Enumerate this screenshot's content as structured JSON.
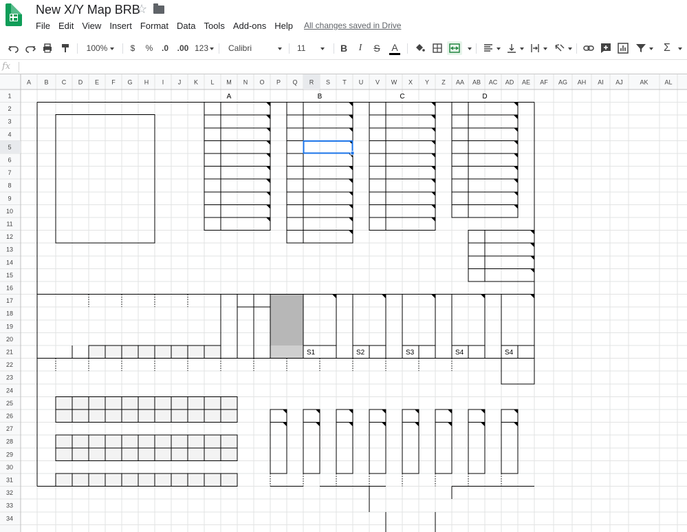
{
  "app": {
    "title": "New X/Y Map BRB",
    "save_status": "All changes saved in Drive"
  },
  "menu": [
    "File",
    "Edit",
    "View",
    "Insert",
    "Format",
    "Data",
    "Tools",
    "Add-ons",
    "Help"
  ],
  "toolbar": {
    "zoom": "100%",
    "currency": "$",
    "percent": "%",
    "decrease_decimal": ".0",
    "increase_decimal": ".00",
    "number_format": "123",
    "font": "Calibri",
    "font_size": "11",
    "bold": "B",
    "italic": "I",
    "strikethrough": "S",
    "text_color": "A",
    "icons": [
      "undo-icon",
      "redo-icon",
      "print-icon",
      "paint-format-icon",
      "fill-color-icon",
      "borders-icon",
      "merge-cells-icon",
      "align-icon",
      "valign-icon",
      "text-wrap-icon",
      "text-rotate-icon",
      "link-icon",
      "comment-icon",
      "chart-icon",
      "filter-icon",
      "functions-icon"
    ]
  },
  "formula_bar": {
    "label": "fx",
    "value": ""
  },
  "colors": {
    "accent": "#0f9d58",
    "selection": "#1a73e8",
    "header_bg": "#f8f9fa",
    "active_header_bg": "#e8eaed",
    "grid_line": "#e2e3e3",
    "gray_fill": "#b7b7b7",
    "light_fill": "#f3f3f3"
  },
  "sheet": {
    "columns": [
      "A",
      "B",
      "C",
      "D",
      "E",
      "F",
      "G",
      "H",
      "I",
      "J",
      "K",
      "L",
      "M",
      "N",
      "O",
      "P",
      "Q",
      "R",
      "S",
      "T",
      "U",
      "V",
      "W",
      "X",
      "Y",
      "Z",
      "AA",
      "AB",
      "AC",
      "AD",
      "AE",
      "AF",
      "AG",
      "AH",
      "AI",
      "AJ",
      "AK",
      "AL"
    ],
    "rows": [
      "1",
      "2",
      "3",
      "4",
      "5",
      "6",
      "7",
      "8",
      "9",
      "10",
      "11",
      "12",
      "13",
      "14",
      "15",
      "16",
      "17",
      "18",
      "19",
      "20",
      "21",
      "22",
      "23",
      "24",
      "25",
      "26",
      "27",
      "28",
      "29",
      "30",
      "31",
      "32",
      "33",
      "34"
    ],
    "active_cell": "R5",
    "section_labels": [
      "A",
      "B",
      "C",
      "D"
    ],
    "slot_labels": [
      "S1",
      "S2",
      "S3",
      "S4",
      "S4"
    ]
  }
}
